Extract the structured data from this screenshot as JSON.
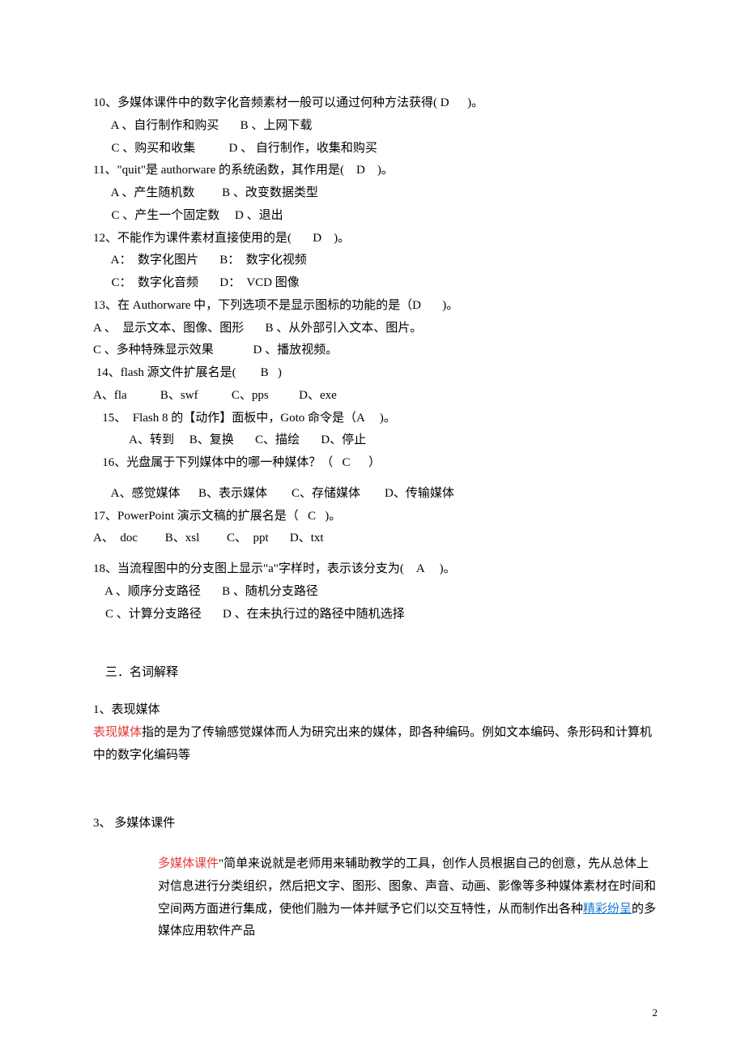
{
  "q10": {
    "stem": "10、多媒体课件中的数字化音频素材一般可以通过何种方法获得( D      )。",
    "ab": "      A 、自行制作和购买       B 、上网下载",
    "cd": "      C 、购买和收集           D 、 自行制作，收集和购买"
  },
  "q11": {
    "stem": "11、\"quit\"是 authorware 的系统函数，其作用是(    D    )。",
    "ab": "      A 、产生随机数         B 、改变数据类型",
    "cd": "      C 、产生一个固定数     D 、退出"
  },
  "q12": {
    "stem": "12、不能作为课件素材直接使用的是(       D    )。",
    "ab": "      A：  数字化图片       B：  数字化视频",
    "cd": "      C：  数字化音频       D：  VCD 图像"
  },
  "q13": {
    "stem": "13、在 Authorware 中，下列选项不是显示图标的功能的是（D       )。",
    "ab": "A 、  显示文本、图像、图形       B 、从外部引入文本、图片。",
    "cd": "C 、多种特殊显示效果             D 、播放视频。"
  },
  "q14": {
    "stem": " 14、flash 源文件扩展名是(        B   )",
    "opts": "A、fla           B、swf           C、pps          D、exe"
  },
  "q15": {
    "stem": "   15、  Flash 8 的【动作】面板中，Goto 命令是（A     )。",
    "opts": "            A、转到     B、复换       C、描绘       D、停止"
  },
  "q16": {
    "stem": "   16、光盘属于下列媒体中的哪一种媒体？（   C      ）",
    "opts": "      A、感觉媒体      B、表示媒体        C、存储媒体        D、传输媒体"
  },
  "q17": {
    "stem": "17、PowerPoint 演示文稿的扩展名是（   C   )。",
    "opts": "A、  doc         B、xsl         C、  ppt       D、txt"
  },
  "q18": {
    "stem": "18、当流程图中的分支图上显示\"a\"字样时，表示该分支为(    A     )。",
    "ab": "    A 、顺序分支路径       B 、随机分支路径",
    "cd": "    C 、计算分支路径       D 、在未执行过的路径中随机选择"
  },
  "section3": "    三．名词解释",
  "def1": {
    "title": "1、表现媒体",
    "red": "表现媒体",
    "body": "指的是为了传输感觉媒体而人为研究出来的媒体，即各种编码。例如文本编码、条形码和计算机中的数字化编码等"
  },
  "def3": {
    "title": "3、 多媒体课件",
    "red": "多媒体课件",
    "body1": "\"简单来说就是老师用来辅助教学的工具，创作人员根据自己的创意，先从总体上对信息进行分类组织，然后把文字、图形、图象、声音、动画、影像等多种媒体素材在时间和空间两方面进行集成，使他们融为一体并赋予它们以交互特性，从而制作出各种",
    "linkword": "精彩纷呈",
    "body2": "的多媒体应用软件产品"
  },
  "pagenum": "2"
}
